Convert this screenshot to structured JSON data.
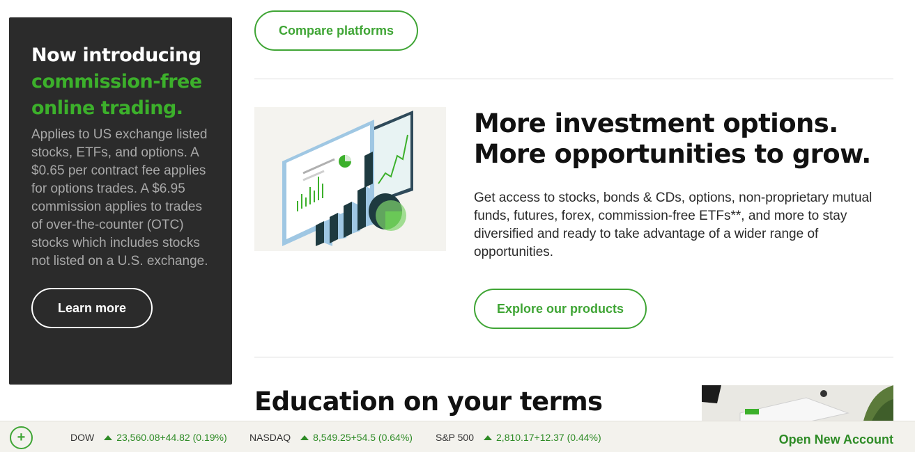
{
  "promo": {
    "title_line1": "Now introducing",
    "title_green1": "commission-free",
    "title_green2": "online trading.",
    "body": "Applies to US exchange listed stocks, ETFs, and options. A $0.65 per contract fee applies for options trades. A $6.95 commission applies to trades of over-the-counter (OTC) stocks which includes stocks not listed on a U.S. exchange.",
    "button": "Learn more"
  },
  "compare": {
    "button": "Compare platforms"
  },
  "invest": {
    "title": "More investment options. More opportunities to grow.",
    "body": "Get access to stocks, bonds & CDs, options, non-proprietary mutual funds, futures, forex, commission-free ETFs**, and more to stay diversified and ready to take advantage of a wider range of opportunities.",
    "button": "Explore our products"
  },
  "education": {
    "title": "Education on your terms"
  },
  "ticker": {
    "expand_icon": "plus-circle-icon",
    "items": [
      {
        "symbol": "DOW",
        "value": "23,560.08+44.82 (0.19%)"
      },
      {
        "symbol": "NASDAQ",
        "value": "8,549.25+54.5 (0.64%)"
      },
      {
        "symbol": "S&P 500",
        "value": "2,810.17+12.37 (0.44%)"
      }
    ],
    "open_account": "Open New Account"
  },
  "colors": {
    "accent_green": "#3fa535",
    "promo_bg": "#2b2b2b",
    "ticker_bg": "#f3f2ed"
  }
}
